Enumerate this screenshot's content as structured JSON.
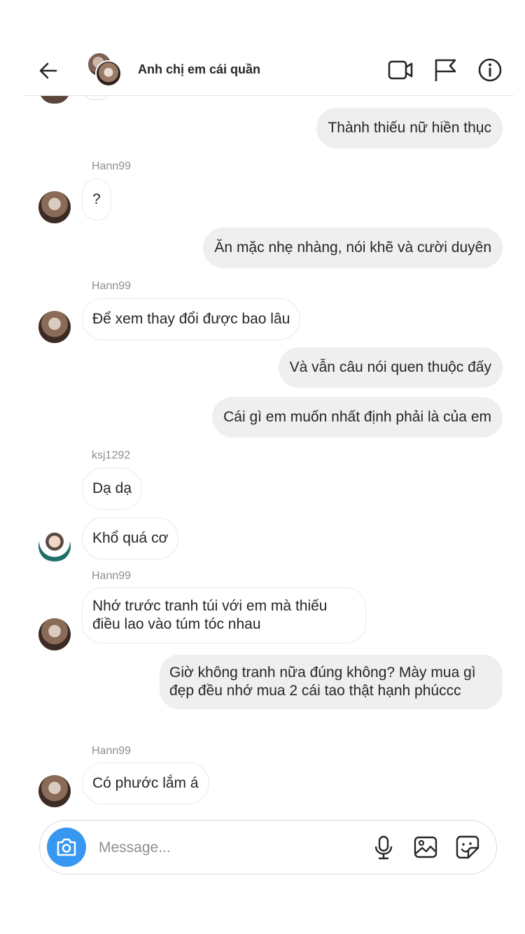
{
  "header": {
    "title": "Anh chị em cái quần",
    "icons": [
      "back-arrow-icon",
      "video-call-icon",
      "flag-icon",
      "info-icon"
    ]
  },
  "messages": [
    {
      "id": 1,
      "direction": "out",
      "text": "Thành thiếu nữ hiền thục"
    },
    {
      "id": 2,
      "direction": "in",
      "sender": "Hann99",
      "text": "?"
    },
    {
      "id": 3,
      "direction": "out",
      "text": "Ăn mặc nhẹ nhàng, nói khẽ và cười duyên"
    },
    {
      "id": 4,
      "direction": "in",
      "sender": "Hann99",
      "text": "Để xem thay đổi được bao lâu"
    },
    {
      "id": 5,
      "direction": "out",
      "text": "Và vẫn câu nói quen thuộc đấy"
    },
    {
      "id": 6,
      "direction": "out",
      "text": "Cái gì em muốn nhất định phải là của em"
    },
    {
      "id": 7,
      "direction": "in",
      "sender": "ksj1292",
      "text": "Dạ dạ"
    },
    {
      "id": 8,
      "direction": "in",
      "text": "Khổ quá cơ"
    },
    {
      "id": 9,
      "direction": "in",
      "sender": "Hann99",
      "text": "Nhớ trước tranh túi với em mà thiếu điều lao vào túm tóc nhau"
    },
    {
      "id": 10,
      "direction": "out",
      "text": "Giờ không tranh nữa đúng không? Mày mua gì đẹp đều nhớ mua 2 cái tao thật hạnh phúccc"
    },
    {
      "id": 11,
      "direction": "in",
      "sender": "Hann99",
      "text": "Có phước lắm á"
    }
  ],
  "composer": {
    "placeholder": "Message...",
    "icons": [
      "camera-icon",
      "microphone-icon",
      "gallery-icon",
      "sticker-icon"
    ],
    "camera_color": "#3897f0"
  },
  "colors": {
    "outgoing_bubble": "#efefef",
    "incoming_border": "#e8e8e8",
    "sender_label": "#8e8e8e"
  }
}
